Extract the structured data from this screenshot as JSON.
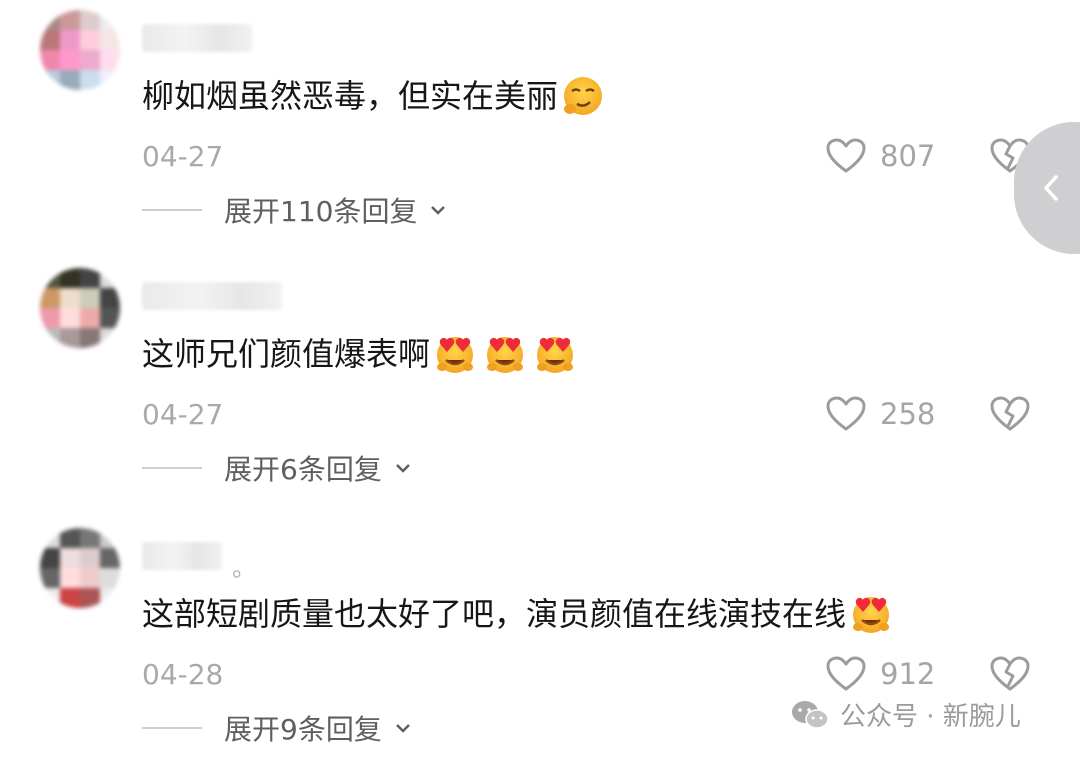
{
  "comments": [
    {
      "text": "柳如烟虽然恶毒，但实在美丽",
      "emojis": [
        "smirk-face-emoji"
      ],
      "date": "04-27",
      "likes": "807",
      "expand_label": "展开110条回复"
    },
    {
      "text": "这师兄们颜值爆表啊",
      "emojis": [
        "heart-eyes-emoji",
        "heart-eyes-emoji",
        "heart-eyes-emoji"
      ],
      "date": "04-27",
      "likes": "258",
      "expand_label": "展开6条回复"
    },
    {
      "text": "这部短剧质量也太好了吧，演员颜值在线演技在线",
      "emojis": [
        "heart-eyes-emoji"
      ],
      "date": "04-28",
      "likes": "912",
      "expand_label": "展开9条回复"
    }
  ],
  "username_suffix_3": "。",
  "watermark": "公众号 · 新腕儿",
  "icons": {
    "like": "heart-outline-icon",
    "dislike": "broken-heart-outline-icon",
    "expand": "chevron-down-icon",
    "side_tab": "chevron-left-icon",
    "watermark": "wechat-icon"
  },
  "colors": {
    "text": "#161616",
    "meta": "#a9a9ab",
    "expand": "#5f5f63",
    "side_tab": "#cfcfd2"
  }
}
